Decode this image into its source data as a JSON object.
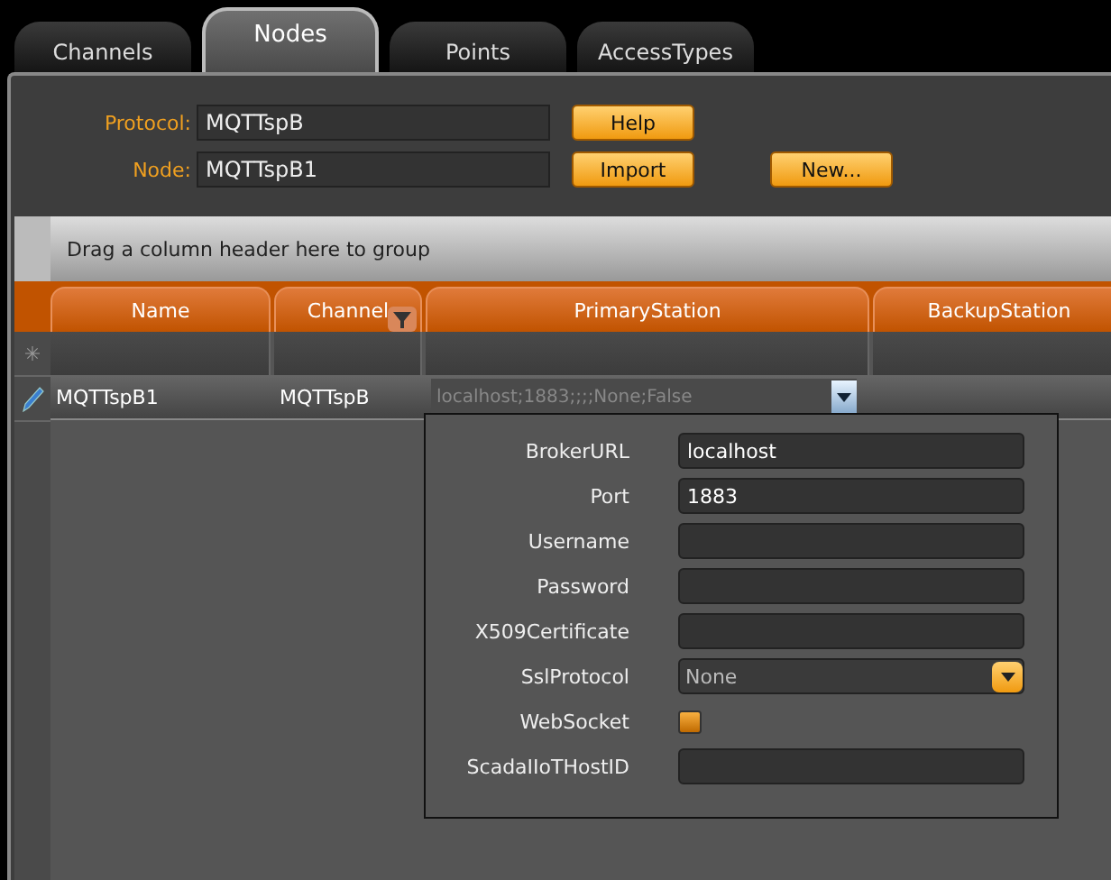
{
  "tabs": [
    {
      "label": "Channels",
      "selected": false
    },
    {
      "label": "Nodes",
      "selected": true
    },
    {
      "label": "Points",
      "selected": false
    },
    {
      "label": "AccessTypes",
      "selected": false
    }
  ],
  "form": {
    "protocol_label": "Protocol:",
    "protocol_value": "MQTTspB",
    "node_label": "Node:",
    "node_value": "MQTTspB1",
    "buttons": [
      "Help",
      "Import",
      "New..."
    ]
  },
  "grid": {
    "group_hint": "Drag a column header here to group",
    "columns": [
      {
        "label": "Name",
        "filter": false
      },
      {
        "label": "Channel",
        "filter": true
      },
      {
        "label": "PrimaryStation",
        "filter": false
      },
      {
        "label": "BackupStation",
        "filter": false
      }
    ],
    "new_row_marker": "✳",
    "rows": [
      {
        "editing": true,
        "cells": [
          "MQTTspB1",
          "MQTTspB",
          "localhost;1883;;;;None;False"
        ]
      }
    ]
  },
  "editor": {
    "fields": [
      {
        "kind": "text",
        "label": "BrokerURL",
        "value": "localhost"
      },
      {
        "kind": "text",
        "label": "Port",
        "value": "1883"
      },
      {
        "kind": "text",
        "label": "Username"
      },
      {
        "kind": "text",
        "label": "Password"
      },
      {
        "kind": "text",
        "label": "X509Certificate"
      },
      {
        "kind": "combo",
        "label": "SslProtocol",
        "value": "None"
      },
      {
        "kind": "checkbox",
        "label": "WebSocket",
        "checked": false
      },
      {
        "kind": "text",
        "label": "ScadaIIoTHostID"
      }
    ]
  }
}
